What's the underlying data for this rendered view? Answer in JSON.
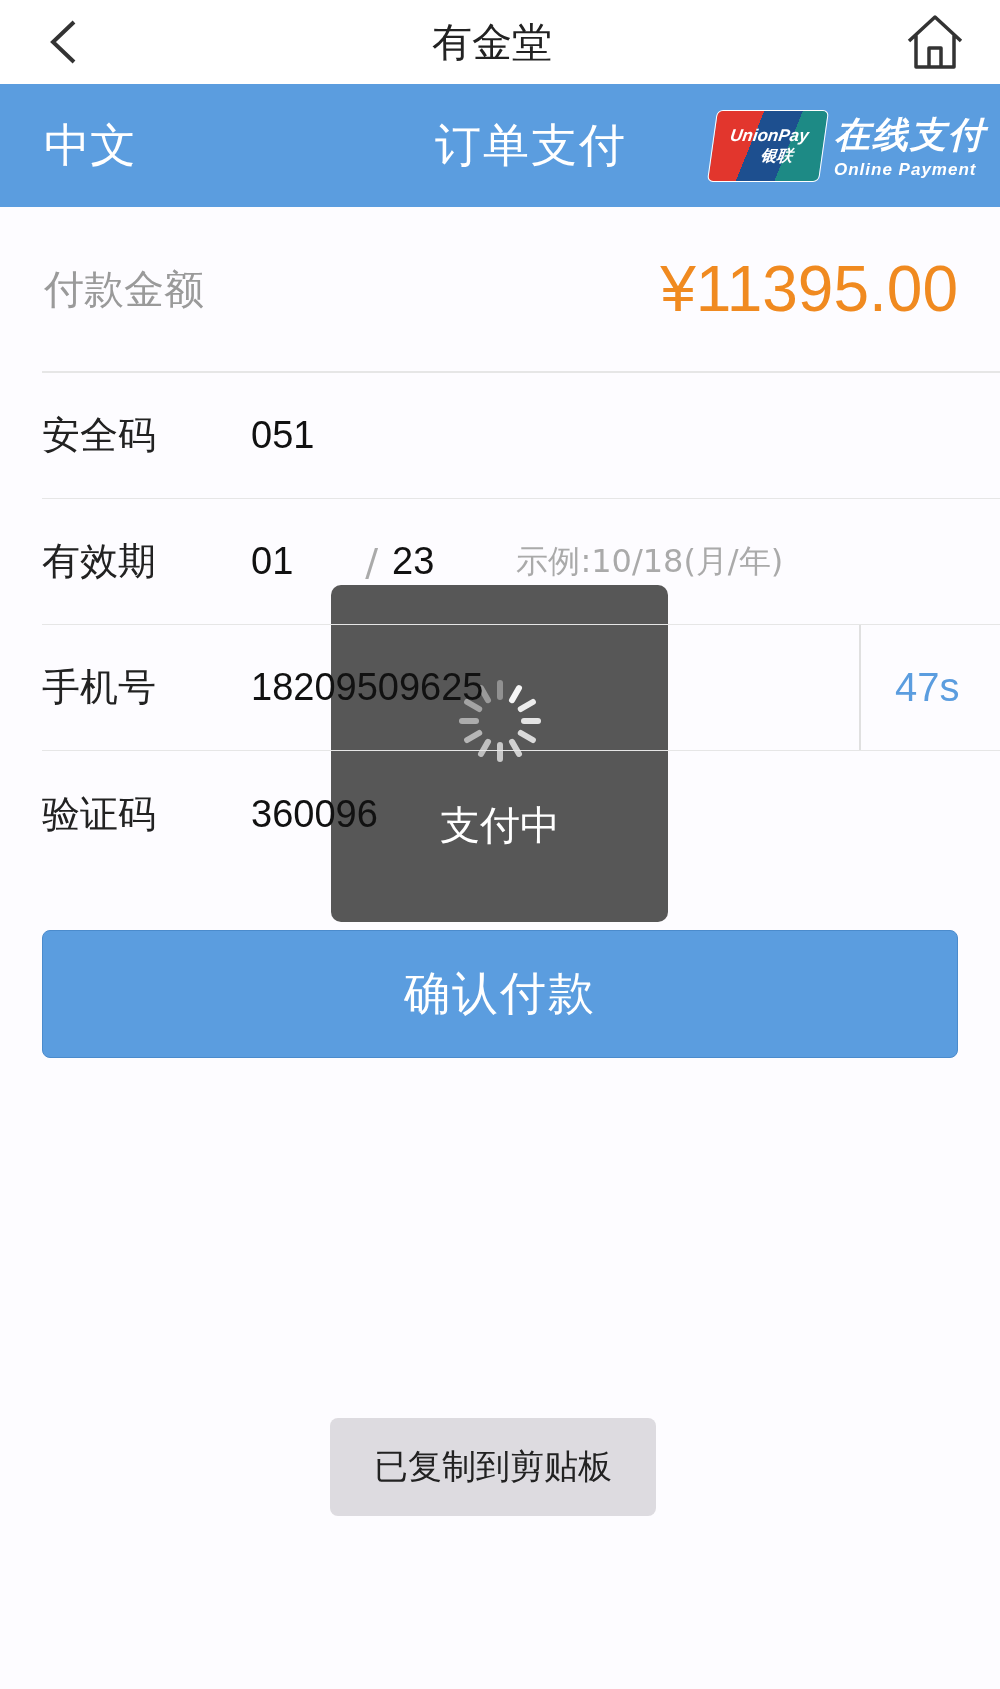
{
  "top_bar": {
    "title": "有金堂"
  },
  "banner": {
    "language": "中文",
    "title": "订单支付",
    "card_logo": {
      "line_1": "UnionPay",
      "line_2": "银联"
    },
    "logo_text": "在线支付",
    "logo_subtext": "Online Payment"
  },
  "amount": {
    "label": "付款金额",
    "value": "¥11395.00"
  },
  "fields": [
    {
      "kind": "text",
      "label": "安全码",
      "value": "051"
    },
    {
      "kind": "expiry",
      "label": "有效期",
      "month": "01",
      "separator": "/",
      "year": "23",
      "hint": "示例:10/18(月/年)"
    },
    {
      "kind": "countdown",
      "label": "手机号",
      "value": "18209509625",
      "countdown": "47s"
    },
    {
      "kind": "text",
      "label": "验证码",
      "value": "360096"
    }
  ],
  "confirm_button": "确认付款",
  "loading": {
    "message": "支付中"
  },
  "toast": "已复制到剪贴板"
}
